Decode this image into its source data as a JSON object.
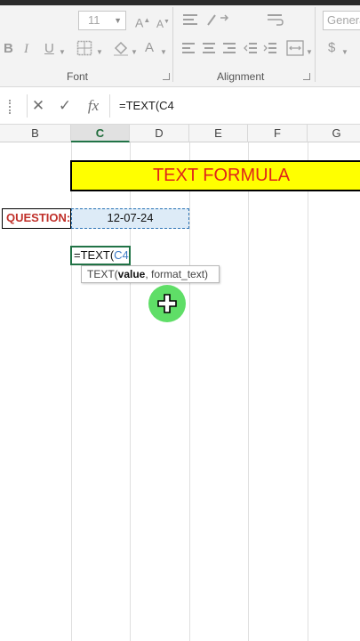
{
  "ribbon": {
    "font_size_value": "11",
    "number_format_value": "Genera",
    "font_group_label": "Font",
    "alignment_group_label": "Alignment",
    "bold_label": "B",
    "italic_label": "I",
    "underline_label": "U",
    "grow_font_label": "A",
    "shrink_font_label": "A",
    "font_color_label": "A",
    "currency_label": "$"
  },
  "formula_bar": {
    "fx_label": "fx",
    "content": "=TEXT(C4"
  },
  "columns": [
    "B",
    "C",
    "D",
    "E",
    "F",
    "G"
  ],
  "active_column": "C",
  "sheet": {
    "title": "TEXT FORMULA",
    "question_label": "QUESTION:",
    "date_value": "12-07-24",
    "edit_prefix": "=TEXT(",
    "edit_ref": "C4",
    "tooltip_func": "TEXT(",
    "tooltip_arg_bold": "value",
    "tooltip_rest": ", format_text)"
  },
  "colors": {
    "title_fill": "#ffff00",
    "title_text": "#e0251a",
    "question_text": "#c0302a",
    "selection_fill": "#ddebf7",
    "selection_border": "#2e75b6",
    "active_cell_border": "#217346",
    "cursor_highlight": "#3cd746"
  }
}
